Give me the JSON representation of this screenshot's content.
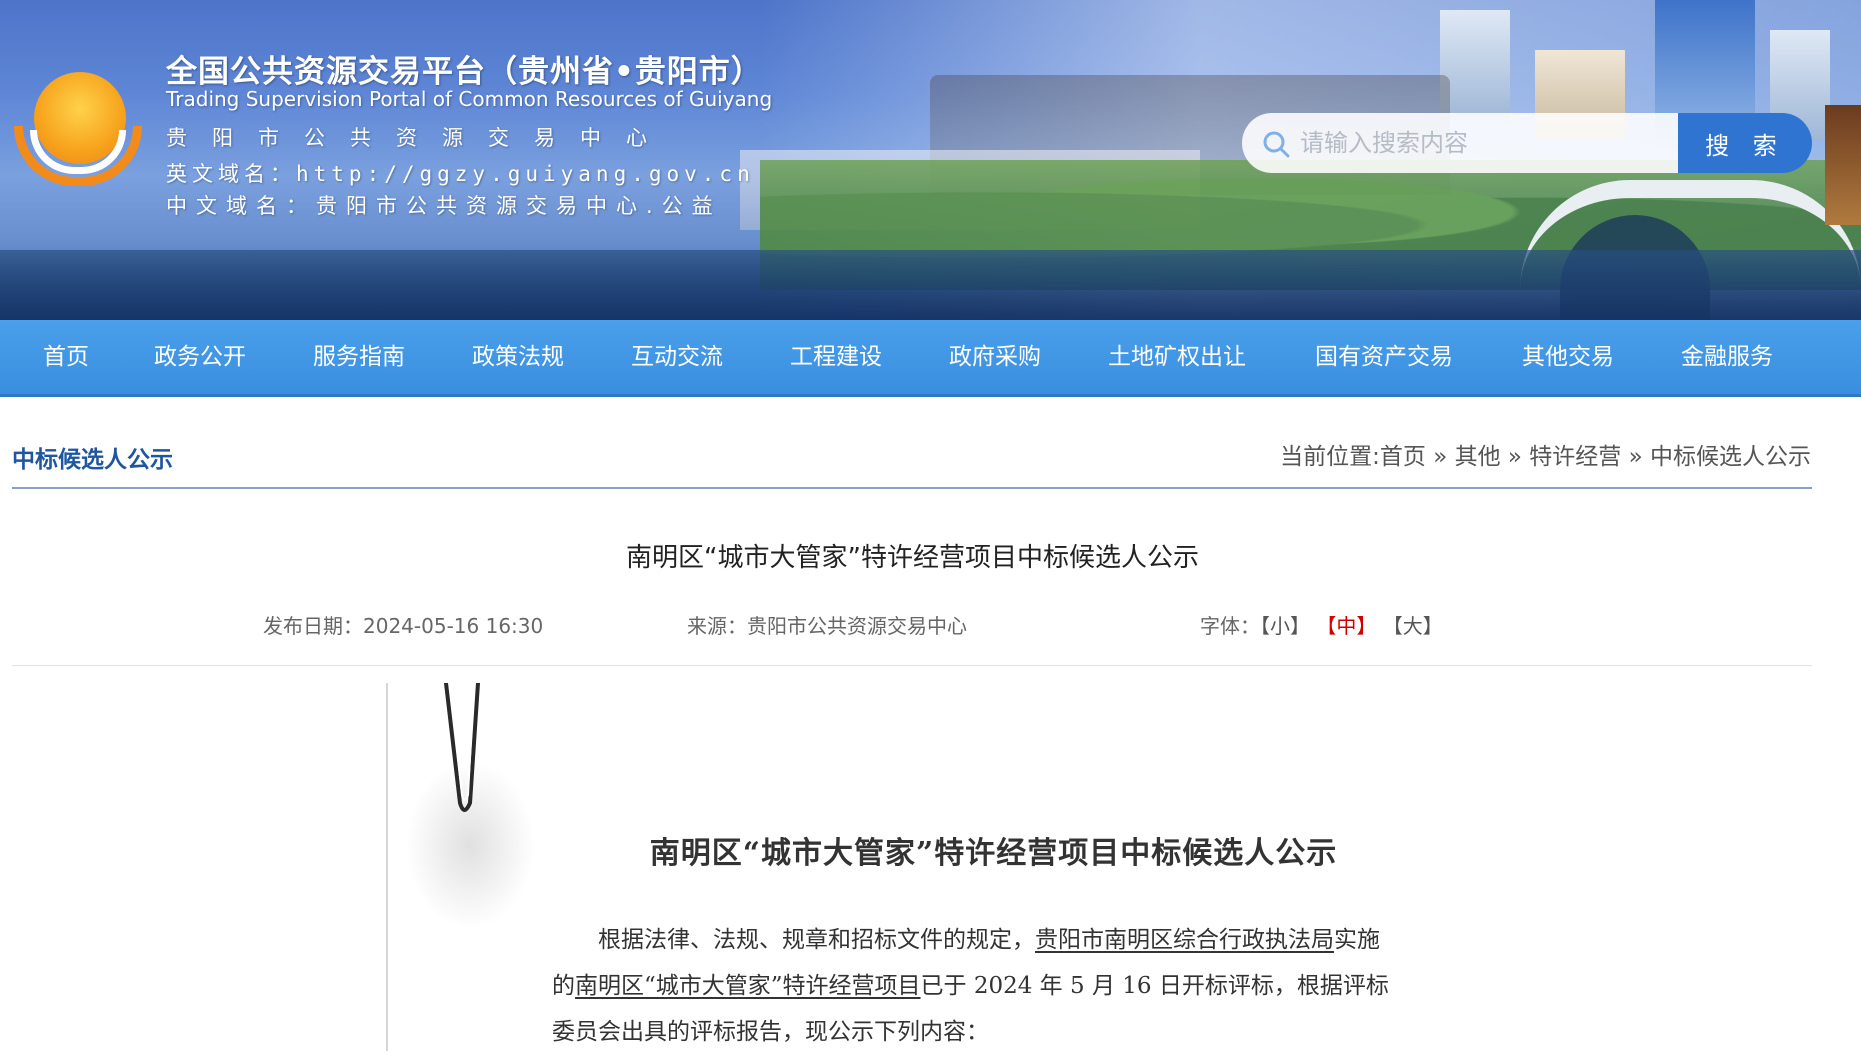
{
  "header": {
    "site_title": "全国公共资源交易平台（贵州省•贵阳市）",
    "site_title_en": "Trading Supervision Portal of Common Resources of Guiyang",
    "site_center": "贵阳市公共资源交易中心",
    "domain_en_label": "英文域名：",
    "domain_en_value": "http://ggzy.guiyang.gov.cn",
    "domain_cn_label": "中文域名：",
    "domain_cn_value": "贵阳市公共资源交易中心.公益"
  },
  "search": {
    "placeholder": "请输入搜索内容",
    "button_label": "搜 索",
    "accent_color": "#2f74d0"
  },
  "nav": {
    "items": [
      {
        "label": "首页"
      },
      {
        "label": "政务公开"
      },
      {
        "label": "服务指南"
      },
      {
        "label": "政策法规"
      },
      {
        "label": "互动交流"
      },
      {
        "label": "工程建设"
      },
      {
        "label": "政府采购"
      },
      {
        "label": "土地矿权出让"
      },
      {
        "label": "国有资产交易"
      },
      {
        "label": "其他交易"
      },
      {
        "label": "金融服务"
      }
    ]
  },
  "page": {
    "section_title": "中标候选人公示",
    "breadcrumb_prefix": "当前位置:",
    "breadcrumb": [
      "首页",
      "其他",
      "特许经营",
      "中标候选人公示"
    ],
    "breadcrumb_sep": "»"
  },
  "article": {
    "title": "南明区“城市大管家”特许经营项目中标候选人公示",
    "date_label": "发布日期：",
    "date": "2024-05-16 16:30",
    "source_label": "来源：",
    "source": "贵阳市公共资源交易中心",
    "font_label": "字体：",
    "font_sizes": [
      "【小】",
      "【中】",
      "【大】"
    ],
    "active_font_size": "【中】"
  },
  "document": {
    "title": "南明区“城市大管家”特许经营项目中标候选人公示",
    "line1_a": "根据法律、法规、规章和招标文件的规定，",
    "line1_b": "贵阳市南明区综合行政执法局",
    "line1_c": "实施",
    "line2_a": "的",
    "line2_b": "南明区“城市大管家”特许经营项目",
    "line2_c": "已于 2024 年 5 月 16 日开标评标，根据评标",
    "line3": "委员会出具的评标报告，现公示下列内容："
  }
}
